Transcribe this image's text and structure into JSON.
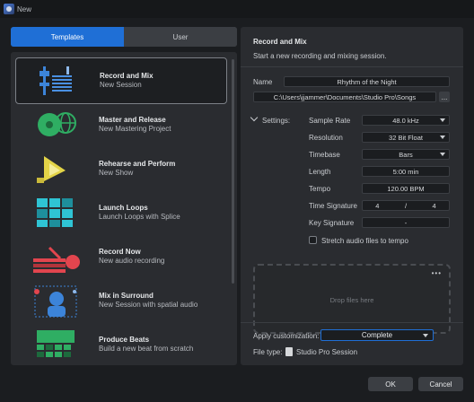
{
  "window": {
    "title": "New"
  },
  "tabs": [
    {
      "label": "Templates"
    },
    {
      "label": "User"
    }
  ],
  "templates": [
    {
      "title": "Record and Mix",
      "subtitle": "New Session"
    },
    {
      "title": "Master and Release",
      "subtitle": "New Mastering Project"
    },
    {
      "title": "Rehearse and Perform",
      "subtitle": "New Show"
    },
    {
      "title": "Launch Loops",
      "subtitle": "Launch Loops with Splice"
    },
    {
      "title": "Record Now",
      "subtitle": "New audio recording"
    },
    {
      "title": "Mix in Surround",
      "subtitle": "New Session with spatial audio"
    },
    {
      "title": "Produce Beats",
      "subtitle": "Build a new beat from scratch"
    }
  ],
  "details": {
    "title": "Record and Mix",
    "description": "Start a new recording and mixing session.",
    "name_label": "Name",
    "name_value": "Rhythm of the Night",
    "path_value": "C:\\Users\\jjammer\\Documents\\Studio Pro\\Songs",
    "path_button": "...",
    "settings_label": "Settings:",
    "settings": {
      "sample_rate_label": "Sample Rate",
      "sample_rate": "48.0 kHz",
      "resolution_label": "Resolution",
      "resolution": "32 Bit Float",
      "timebase_label": "Timebase",
      "timebase": "Bars",
      "length_label": "Length",
      "length": "5:00 min",
      "tempo_label": "Tempo",
      "tempo": "120.00 BPM",
      "time_sig_label": "Time Signature",
      "time_sig_num": "4",
      "time_sig_sep": "/",
      "time_sig_den": "4",
      "key_sig_label": "Key Signature",
      "key_sig": "-",
      "stretch_label": "Stretch audio files to tempo"
    },
    "dropzone_text": "Drop files here",
    "dropzone_more": "•••",
    "customization_label": "Apply customization:",
    "customization_value": "Complete",
    "filetype_label": "File type:",
    "filetype_value": "Studio Pro Session"
  },
  "buttons": {
    "ok": "OK",
    "cancel": "Cancel"
  },
  "colors": {
    "accent": "#1f6fd6",
    "background": "#1b1d20",
    "panel": "#2a2c30"
  }
}
